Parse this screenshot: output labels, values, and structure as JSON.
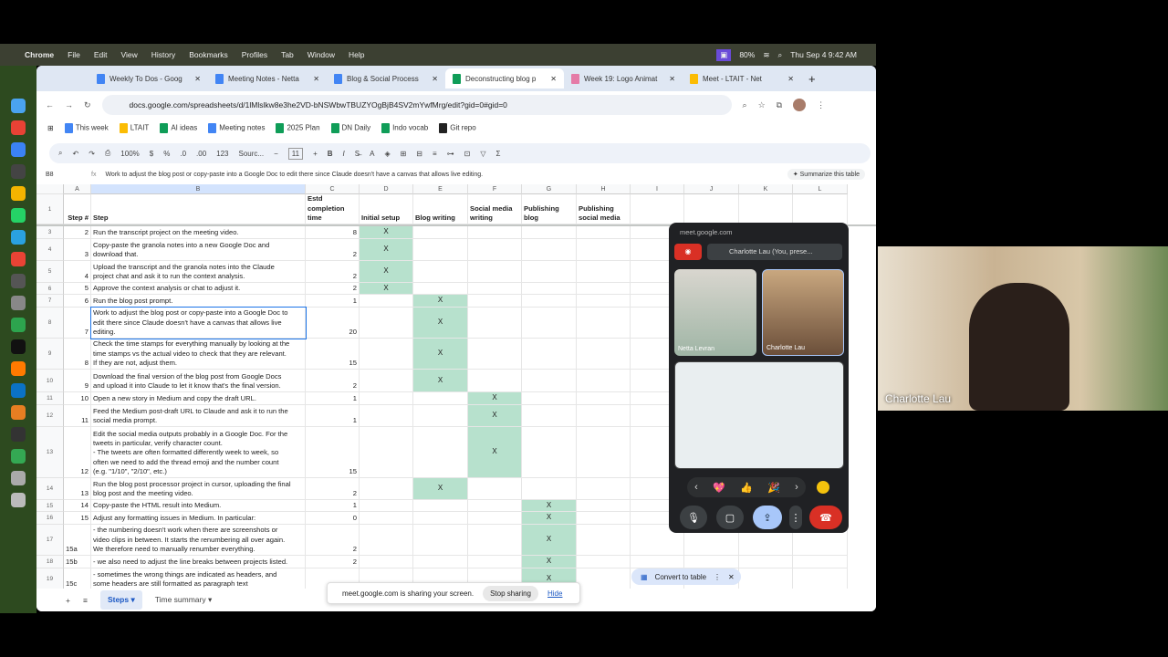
{
  "menubar": {
    "app": "Chrome",
    "items": [
      "File",
      "Edit",
      "View",
      "History",
      "Bookmarks",
      "Profiles",
      "Tab",
      "Window",
      "Help"
    ],
    "battery": "80%",
    "datetime": "Thu Sep 4  9:42 AM"
  },
  "browser": {
    "tabs": [
      {
        "label": "Weekly To Dos - Goog",
        "color": "#4285f4"
      },
      {
        "label": "Meeting Notes - Netta",
        "color": "#4285f4"
      },
      {
        "label": "Blog & Social Process",
        "color": "#4285f4"
      },
      {
        "label": "Deconstructing blog p",
        "color": "#0f9d58",
        "active": true
      },
      {
        "label": "Week 19: Logo Animat",
        "color": "#e57ba7"
      },
      {
        "label": "Meet - LTAIT - Net",
        "color": "#fbbc04"
      }
    ],
    "url": "docs.google.com/spreadsheets/d/1lMlslkw8e3he2VD-bNSWbwTBUZYOgBjB4SV2mYwfMrg/edit?gid=0#gid=0",
    "bookmarks": [
      {
        "label": "This week",
        "color": "#4285f4"
      },
      {
        "label": "LTAIT",
        "color": "#fbbc04"
      },
      {
        "label": "AI ideas",
        "color": "#0f9d58"
      },
      {
        "label": "Meeting notes",
        "color": "#4285f4"
      },
      {
        "label": "2025 Plan",
        "color": "#0f9d58"
      },
      {
        "label": "DN Daily",
        "color": "#0f9d58"
      },
      {
        "label": "Indo vocab",
        "color": "#0f9d58"
      },
      {
        "label": "Git repo",
        "color": "#222222"
      }
    ]
  },
  "toolbar": {
    "zoom": "100%",
    "currency": "$",
    "percent": "%",
    "dec_less": ".0",
    "dec_more": ".00",
    "format": "123",
    "font": "Sourc...",
    "font_size": "11",
    "bold": "B",
    "italic": "I"
  },
  "formula_bar": {
    "cell_ref": "B8",
    "fx": "fx",
    "formula": "Work to adjust the blog post or copy-paste into a Google Doc to edit there since Claude doesn't have a canvas that allows live editing.",
    "summarize": "✦ Summarize this table"
  },
  "columns": [
    "A",
    "B",
    "C",
    "D",
    "E",
    "F",
    "G",
    "H",
    "I",
    "J",
    "K",
    "L"
  ],
  "header_row": {
    "row": "1",
    "step_num": "Step #",
    "step": "Step",
    "time": "Estd\ncompletion\ntime",
    "d": "Initial setup",
    "e": "Blog writing",
    "f": "Social media\nwriting",
    "g": "Publishing\nblog",
    "h": "Publishing\nsocial media"
  },
  "rows": [
    {
      "row": "3",
      "num": "2",
      "step": "Run the transcript project on the meeting video.",
      "time": "8",
      "mark": "D"
    },
    {
      "row": "4",
      "num": "3",
      "step": "Copy-paste the granola notes into a new Google Doc and\ndownload that.",
      "time": "2",
      "mark": "D"
    },
    {
      "row": "5",
      "num": "4",
      "step": "Upload the transcript and the granola notes into the Claude\nproject chat and ask it to run the context analysis.",
      "time": "2",
      "mark": "D"
    },
    {
      "row": "6",
      "num": "5",
      "step": "Approve the context analysis or chat to adjust it.",
      "time": "2",
      "mark": "D"
    },
    {
      "row": "7",
      "num": "6",
      "step": "Run the blog post prompt.",
      "time": "1",
      "mark": "E"
    },
    {
      "row": "8",
      "num": "7",
      "step": "Work to adjust the blog post or copy-paste into a Google Doc to\nedit there since Claude doesn't have a canvas that allows live\nediting.",
      "time": "20",
      "mark": "E"
    },
    {
      "row": "9",
      "num": "8",
      "step": "Check the time stamps for everything manually by looking at the\ntime stamps vs the actual video to check that they are relevant.\nIf they are not, adjust them.",
      "time": "15",
      "mark": "E"
    },
    {
      "row": "10",
      "num": "9",
      "step": "Download the final version of the blog post from Google Docs\nand upload it into Claude to let it know that's the final version.",
      "time": "2",
      "mark": "E"
    },
    {
      "row": "11",
      "num": "10",
      "step": "Open a new story in Medium and copy the draft URL.",
      "time": "1",
      "mark": "F"
    },
    {
      "row": "12",
      "num": "11",
      "step": "Feed the Medium post-draft URL to Claude and ask it to run the\nsocial media prompt.",
      "time": "1",
      "mark": "F"
    },
    {
      "row": "13",
      "num": "12",
      "step": "Edit the social media outputs probably in a Google Doc. For the\ntweets in particular, verify character count.\n- The tweets are often formatted differently week to week, so\noften we need to add the thread emoji and the number count\n(e.g. \"1/10\", \"2/10\", etc.)",
      "time": "15",
      "mark": "F"
    },
    {
      "row": "14",
      "num": "13",
      "step": "Run the blog post processor project in cursor, uploading the final\nblog post and the meeting video.",
      "time": "2",
      "mark": "E"
    },
    {
      "row": "15",
      "num": "14",
      "step": "Copy-paste the HTML result into Medium.",
      "time": "1",
      "mark": "G"
    },
    {
      "row": "16",
      "num": "15",
      "step": "Adjust any formatting issues in Medium. In particular:",
      "time": "0",
      "mark": "G"
    },
    {
      "row": "17",
      "num": "15a",
      "step": "- the numbering doesn't work when there are screenshots or\nvideo clips in between. It starts the renumbering all over again.\nWe therefore need to manually renumber everything.",
      "time": "2",
      "mark": "G"
    },
    {
      "row": "18",
      "num": "15b",
      "step": "- we also need to adjust the line breaks between projects listed.",
      "time": "2",
      "mark": "G"
    },
    {
      "row": "19",
      "num": "15c",
      "step": "- sometimes the wrong things are indicated as headers, and\nsome headers are still formatted as paragraph text",
      "time": "",
      "mark": "G"
    }
  ],
  "mark_symbol": "X",
  "sheets": {
    "add": "+",
    "all": "≡",
    "tabs": [
      "Steps ▾",
      "Time summary ▾"
    ]
  },
  "share_bar": {
    "message": "meet.google.com is sharing your screen.",
    "stop": "Stop sharing",
    "hide": "Hide"
  },
  "convert": {
    "label": "Convert to table",
    "close": "✕"
  },
  "meet": {
    "domain": "meet.google.com",
    "presenter": "Charlotte Lau (You, prese...",
    "participants": [
      "Netta Levran",
      "Charlotte Lau"
    ],
    "reactions": [
      "‹",
      "💖",
      "👍",
      "🎉",
      "›"
    ]
  },
  "webcam": {
    "name": "Charlotte Lau"
  },
  "colors": {
    "accent": "#1a73e8",
    "green_fill": "#b7e1cd",
    "end_call": "#d93025"
  }
}
